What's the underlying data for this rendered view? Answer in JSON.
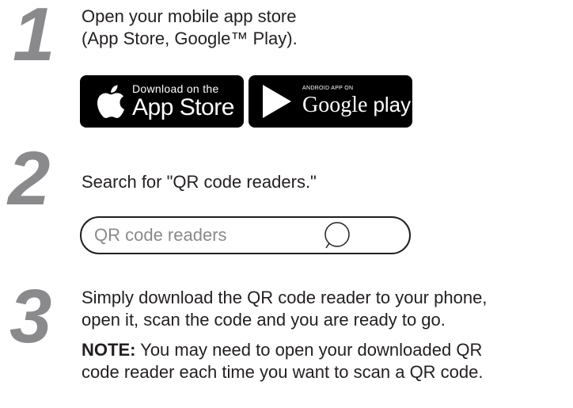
{
  "steps": [
    {
      "number": "1",
      "lines": [
        "Open your mobile app store",
        "(App Store, Google™ Play)."
      ]
    },
    {
      "number": "2",
      "lines": [
        "Search for \"QR code readers.\""
      ]
    },
    {
      "number": "3",
      "lines": [
        "Simply download the QR code reader to your phone,",
        "open it, scan the code and you are ready to go."
      ]
    }
  ],
  "badges": {
    "app_store": {
      "small": "Download on the",
      "big": "App Store"
    },
    "google_play": {
      "small": "ANDROID APP ON",
      "big_google": "Google",
      "big_play": "play"
    }
  },
  "search": {
    "value": "QR code readers"
  },
  "note": {
    "label": "NOTE:",
    "line1_rest": " You may need to open your downloaded QR",
    "line2": "code reader each time you want to scan a QR code."
  },
  "icons": {
    "apple": "apple-logo-icon",
    "play": "google-play-triangle-icon",
    "search": "search-icon"
  },
  "colors": {
    "step_number": "#8a8a8c",
    "text": "#231f20",
    "badge_bg": "#000000",
    "placeholder": "#8a8a8c"
  }
}
